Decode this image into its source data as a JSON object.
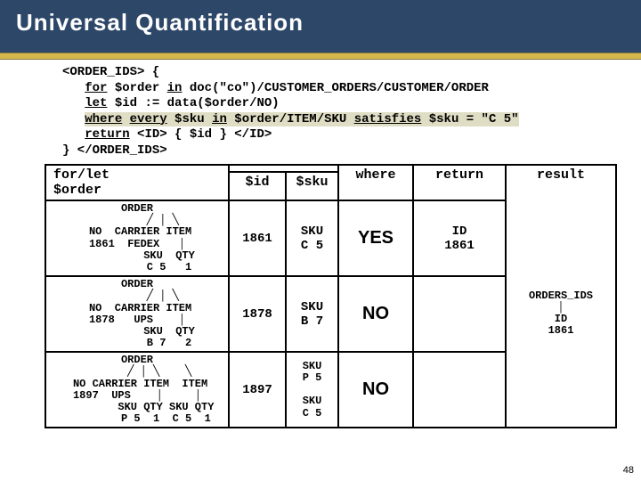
{
  "header": {
    "title": "Universal Quantification"
  },
  "code": {
    "l1a": "<ORDER_IDS> {",
    "l2a": "for",
    "l2b": " $order ",
    "l2c": "in",
    "l2d": " doc(\"co\")/CUSTOMER_ORDERS/CUSTOMER/ORDER",
    "l3a": "let",
    "l3b": " $id := data($order/NO)",
    "l4a": "where",
    "l4b": " ",
    "l4c": "every",
    "l4d": " $sku ",
    "l4e": "in",
    "l4f": " $order/ITEM/SKU ",
    "l4g": "satisfies",
    "l4h": " $sku = \"C 5\"",
    "l5a": "return",
    "l5b": " <ID> { $id } </ID>",
    "l6a": "} </ORDER_IDS>"
  },
  "cols": {
    "forlet": "for/let",
    "order": "$order",
    "id": "$id",
    "sku": "$sku",
    "where": "where",
    "ret": "return",
    "result": "result"
  },
  "rows": [
    {
      "tree": "ORDER\n        ╱ │ ╲\n NO  CARRIER ITEM\n1861  FEDEX   │\n          SKU  QTY\n          C 5   1",
      "id": "1861",
      "skus": "SKU\nC 5",
      "where": "YES",
      "ret": "ID\n1861"
    },
    {
      "tree": "ORDER\n        ╱ │ ╲\n NO  CARRIER ITEM\n1878   UPS    │\n          SKU  QTY\n          B 7   2",
      "id": "1878",
      "skus": "SKU\nB 7",
      "where": "NO",
      "ret": ""
    },
    {
      "tree": "ORDER\n       ╱ │ ╲    ╲\n NO CARRIER ITEM  ITEM\n1897  UPS    │     │\n         SKU QTY SKU QTY\n         P 5  1  C 5  1",
      "id": "1897",
      "skus": "SKU\nP 5\n\nSKU\nC 5",
      "where": "NO",
      "ret": ""
    }
  ],
  "result_tree": "ORDERS_IDS\n│\nID\n1861",
  "pagenum": "48"
}
